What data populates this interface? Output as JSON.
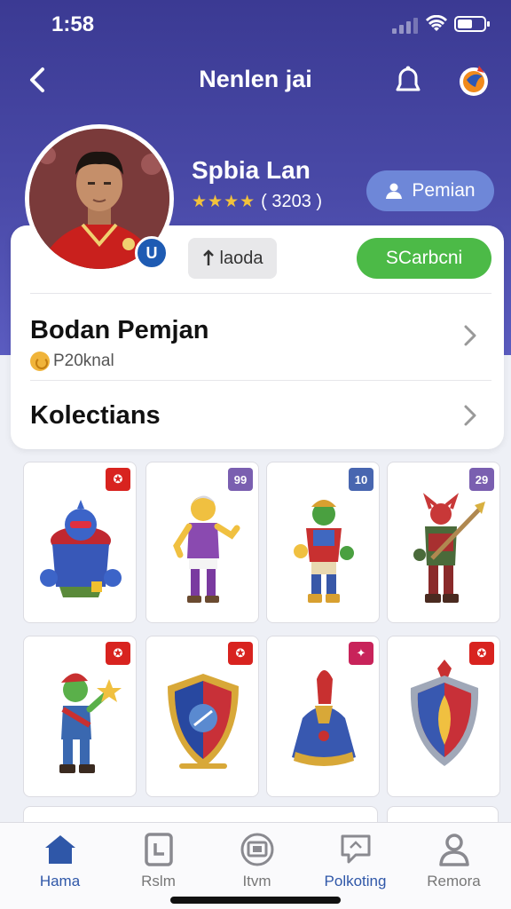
{
  "status_bar": {
    "time": "1:58"
  },
  "header": {
    "title": "Nenlen jai"
  },
  "profile": {
    "name": "Spbia Lan",
    "stars": "★★★★",
    "rating_count": "( 3203 )",
    "player_button": "Pemian",
    "badge_letter": "U"
  },
  "actions": {
    "secondary_label": "laoda",
    "primary_label": "SCarbcni"
  },
  "menu": {
    "row1_title": "Bodan Pemjan",
    "row1_subtitle": "P20knal",
    "row2_title": "Kolectians"
  },
  "collection": {
    "items": [
      {
        "name": "item-blue-robot",
        "badge_color": "#d8231f"
      },
      {
        "name": "item-purple-hero",
        "badge_color": "#7a5fb0",
        "badge_text": "99"
      },
      {
        "name": "item-armored-goblin",
        "badge_color": "#4866b0",
        "badge_text": "10"
      },
      {
        "name": "item-red-warrior",
        "badge_color": "#7a5fb0",
        "badge_text": "29"
      },
      {
        "name": "item-green-elf",
        "badge_color": "#d8231f"
      },
      {
        "name": "item-shield-emblem",
        "badge_color": "#d8231f"
      },
      {
        "name": "item-cloaked-figure",
        "badge_color": "#c8235a"
      },
      {
        "name": "item-crest-shield",
        "badge_color": "#d8231f"
      }
    ]
  },
  "bottom_nav": {
    "items": [
      {
        "label": "Hama",
        "icon": "home-icon"
      },
      {
        "label": "Rslm",
        "icon": "document-icon"
      },
      {
        "label": "Itvm",
        "icon": "monitor-icon"
      },
      {
        "label": "Polkoting",
        "icon": "chat-icon"
      },
      {
        "label": "Remora",
        "icon": "profile-icon"
      }
    ]
  }
}
